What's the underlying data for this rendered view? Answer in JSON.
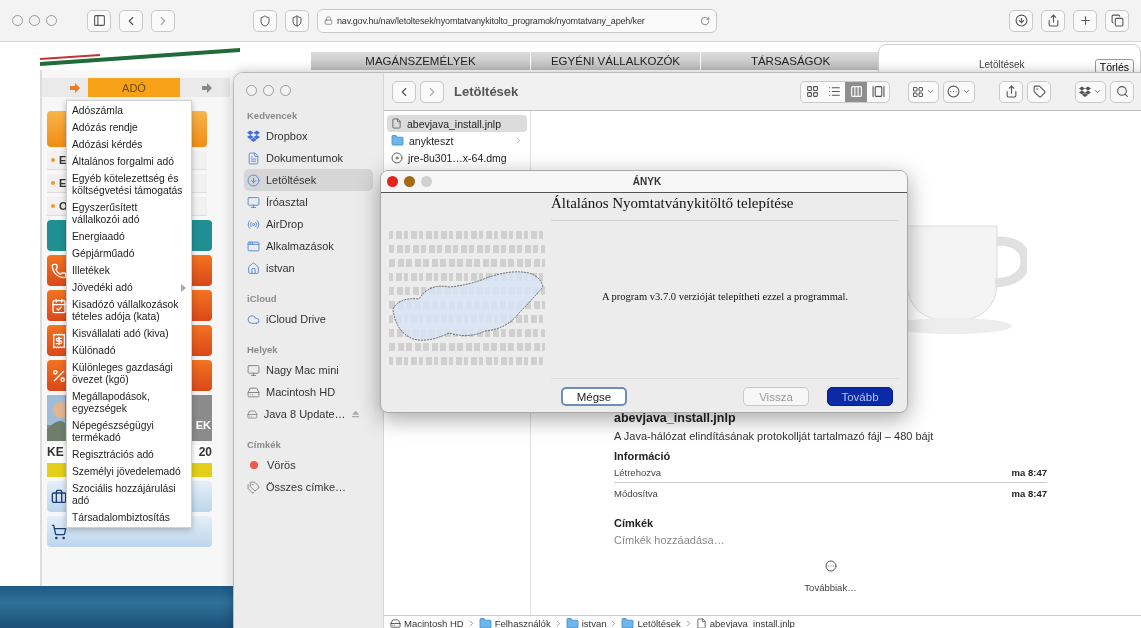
{
  "browser": {
    "url": "nav.gov.hu/nav/letoltesek/nyomtatvanykitolto_programok/nyomtatvany_apeh/ker",
    "downloads_popover": {
      "title": "Letöltések",
      "clear_button": "Törlés"
    }
  },
  "site": {
    "nav_tabs": [
      "MAGÁNSZEMÉLYEK",
      "EGYÉNI VÁLLALKOZÓK",
      "TÁRSASÁGOK"
    ],
    "menu_tab": "ADÓ",
    "side_links": [
      "E",
      "E",
      "O"
    ],
    "banner_texts": [
      "EK",
      "KE",
      "20"
    ],
    "menu": [
      {
        "label": "Adószámla",
        "submenu": false
      },
      {
        "label": "Adózás rendje",
        "submenu": false
      },
      {
        "label": "Adózási kérdés",
        "submenu": false
      },
      {
        "label": "Általános forgalmi adó",
        "submenu": false
      },
      {
        "label": "Egyéb kötelezettség és költségvetési támogatás",
        "submenu": false
      },
      {
        "label": "Egyszerűsített vállalkozói adó",
        "submenu": false
      },
      {
        "label": "Energiaadó",
        "submenu": false
      },
      {
        "label": "Gépjárműadó",
        "submenu": false
      },
      {
        "label": "Illetékek",
        "submenu": false
      },
      {
        "label": "Jövedéki adó",
        "submenu": true
      },
      {
        "label": "Kisadózó vállalkozások tételes adója (kata)",
        "submenu": false
      },
      {
        "label": "Kisvállalati adó (kiva)",
        "submenu": false
      },
      {
        "label": "Különadó",
        "submenu": false
      },
      {
        "label": "Különleges gazdasági övezet (kgö)",
        "submenu": false
      },
      {
        "label": "Megállapodások, egyezségek",
        "submenu": false
      },
      {
        "label": "Népegészségügyi termékadó",
        "submenu": false
      },
      {
        "label": "Regisztrációs adó",
        "submenu": false
      },
      {
        "label": "Személyi jövedelemadó",
        "submenu": false
      },
      {
        "label": "Szociális hozzájárulási adó",
        "submenu": false
      },
      {
        "label": "Társadalombiztosítás",
        "submenu": false
      }
    ]
  },
  "finder": {
    "title": "Letöltések",
    "view_modes": [
      {
        "kind": "icons",
        "selected": false
      },
      {
        "kind": "list",
        "selected": false
      },
      {
        "kind": "columns",
        "selected": true
      },
      {
        "kind": "gallery",
        "selected": false
      }
    ],
    "sidebar": [
      {
        "heading": "Kedvencek",
        "items": [
          {
            "label": "Dropbox",
            "kind": "dropbox",
            "selected": false
          },
          {
            "label": "Dokumentumok",
            "kind": "document",
            "selected": false
          },
          {
            "label": "Letöltések",
            "kind": "download",
            "selected": true
          },
          {
            "label": "Íróasztal",
            "kind": "desktop",
            "selected": false
          },
          {
            "label": "AirDrop",
            "kind": "airdrop",
            "selected": false
          },
          {
            "label": "Alkalmazások",
            "kind": "apps",
            "selected": false
          },
          {
            "label": "istvan",
            "kind": "home",
            "selected": false
          }
        ]
      },
      {
        "heading": "iCloud",
        "items": [
          {
            "label": "iCloud Drive",
            "kind": "cloud",
            "selected": false
          }
        ]
      },
      {
        "heading": "Helyek",
        "items": [
          {
            "label": "Nagy Mac mini",
            "kind": "computer",
            "selected": false
          },
          {
            "label": "Macintosh HD",
            "kind": "disk",
            "selected": false
          },
          {
            "label": "Java 8 Update…",
            "kind": "ejectable",
            "selected": false
          }
        ]
      },
      {
        "heading": "Címkék",
        "items": [
          {
            "label": "Vörös",
            "kind": "tag",
            "color": "#f0584c",
            "selected": false
          },
          {
            "label": "Összes címke…",
            "kind": "tags",
            "selected": false
          }
        ]
      }
    ],
    "files": [
      {
        "name": "abevjava_install.jnlp",
        "kind": "file",
        "selected": true
      },
      {
        "name": "anykteszt",
        "kind": "folder",
        "selected": false
      },
      {
        "name": "jre-8u301…x-64.dmg",
        "kind": "disk-image",
        "selected": false
      }
    ],
    "preview": {
      "file_name": "abevjava_install.jnlp",
      "description": "A Java-hálózat elindításának protokollját tartalmazó fájl – 480 bájt",
      "info_heading": "Információ",
      "info": [
        {
          "label": "Létrehozva",
          "value": "ma 8:47"
        },
        {
          "label": "Módosítva",
          "value": "ma 8:47"
        }
      ],
      "tags_heading": "Címkék",
      "tags_placeholder": "Címkék hozzáadása…",
      "more": "Továbbiak…"
    },
    "path": [
      {
        "label": "Macintosh HD",
        "kind": "disk"
      },
      {
        "label": "Felhasználók",
        "kind": "folder"
      },
      {
        "label": "istvan",
        "kind": "folder"
      },
      {
        "label": "Letöltések",
        "kind": "folder"
      },
      {
        "label": "abevjava_install.jnlp",
        "kind": "file"
      }
    ]
  },
  "installer": {
    "title": "ÁNYK",
    "heading": "Általános Nyomtatványkitöltő telepítése",
    "message": "A program v3.7.0 verzióját telepítheti ezzel a programmal.",
    "buttons": [
      {
        "label": "Mégse",
        "kind": "focused",
        "disabled": false
      },
      {
        "label": "Vissza",
        "kind": "plain",
        "disabled": true
      },
      {
        "label": "Tovább",
        "kind": "default",
        "disabled": false
      }
    ]
  }
}
